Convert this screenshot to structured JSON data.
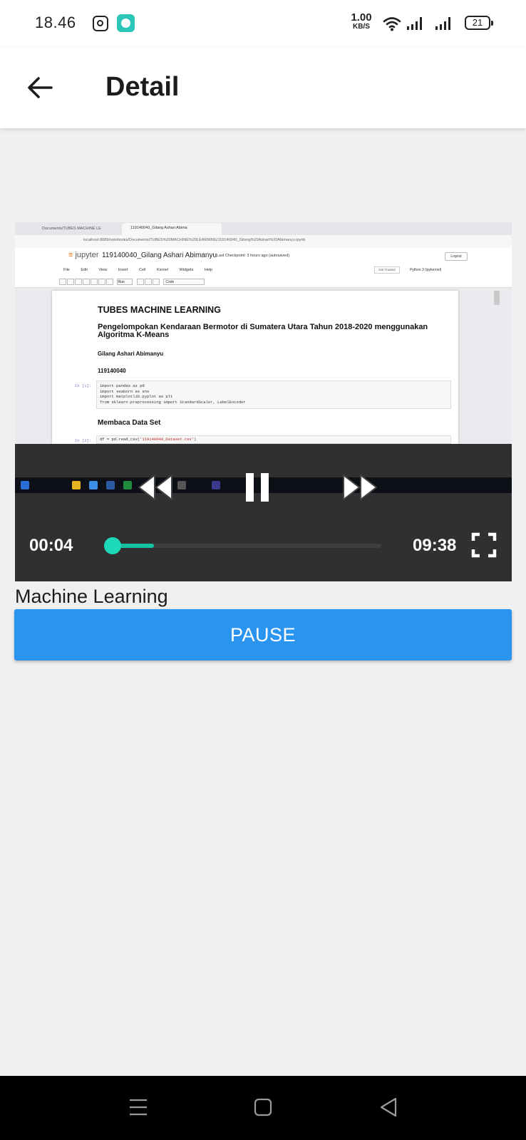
{
  "status_bar": {
    "time": "18.46",
    "net_speed_value": "1.00",
    "net_speed_unit": "KB/S",
    "battery": "21",
    "app_icons": [
      "instagram-icon",
      "chat-app-icon"
    ]
  },
  "app_bar": {
    "title": "Detail",
    "back_icon": "arrow-left-icon"
  },
  "video_frame": {
    "browser_tab_1": "Documents/TUBES MACHINE LE",
    "browser_tab_2": "119140040_Gilang Ashari Abima",
    "url": "localhost:8889/notebooks/Documents/TUBES%20MACHINE%20LEARNING/119140040_Gilang%20Ashari%20Abimanyu.ipynb",
    "jupyter_logo": "jupyter",
    "notebook_name": "119140040_Gilang Ashari Abimanyu",
    "checkpoint": "Last Checkpoint: 3 hours ago  (autosaved)",
    "logout": "Logout",
    "menu": "File Edit View Insert Cell Kernel Widgets Help",
    "trusted": "Not Trusted",
    "kernel": "Python 3 (ipykernel)",
    "run_label": "Run",
    "cell_type": "Code",
    "heading": "TUBES MACHINE LEARNING",
    "subtitle": "Pengelompokan Kendaraan Bermotor di Sumatera Utara Tahun 2018-2020 menggunakan Algoritma K-Means",
    "author": "Gilang Ashari Abimanyu",
    "nim": "119140040",
    "cell1_prompt": "In [1]:",
    "cell1_lines": [
      "import pandas as pd",
      "import seaborn as sns",
      "import matplotlib.pyplot as plt",
      "from sklearn.preprocessing import StandardScaler, LabelEncoder"
    ],
    "section_heading": "Membaca Data Set",
    "cell2_prompt": "In [2]:",
    "cell2_code_prefix": "df = pd.read_csv(",
    "cell2_code_string": "'119140040_Dataset.csv'",
    "cell2_code_suffix": ")"
  },
  "player": {
    "current_time": "00:04",
    "duration": "09:38",
    "progress_fraction": 0.007,
    "buffered_fraction": 0.16,
    "controls": [
      "rewind-icon",
      "pause-icon",
      "fast-forward-icon",
      "fullscreen-icon"
    ],
    "accent_color": "#1ed9b8"
  },
  "content": {
    "video_label": "Machine Learning",
    "pause_button_label": "PAUSE",
    "button_color": "#2a95f0"
  },
  "nav_bar": {
    "buttons": [
      "menu-icon",
      "home-icon",
      "back-triangle-icon"
    ]
  }
}
